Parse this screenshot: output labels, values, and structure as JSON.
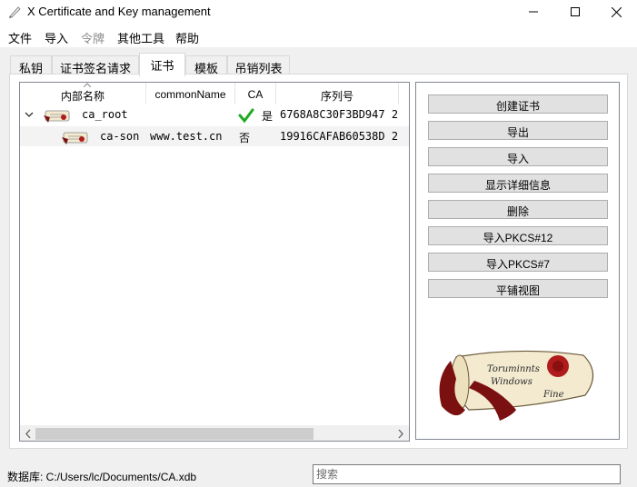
{
  "window": {
    "title": "X Certificate and Key management"
  },
  "menu": [
    "文件",
    "导入",
    "令牌",
    "其他工具",
    "帮助"
  ],
  "tabs": [
    "私钥",
    "证书签名请求",
    "证书",
    "模板",
    "吊销列表"
  ],
  "active_tab": "证书",
  "columns": [
    "内部名称",
    "commonName",
    "CA",
    "序列号"
  ],
  "rows": [
    {
      "name": "ca_root",
      "common_name": "",
      "ca": "是",
      "ca_valid": true,
      "serial": "6768A8C30F3BD947 2"
    },
    {
      "name": "ca-son",
      "common_name": "www.test.cn",
      "ca": "否",
      "ca_valid": false,
      "serial": "19916CAFAB60538D 2"
    }
  ],
  "buttons": [
    "创建证书",
    "导出",
    "导入",
    "显示详细信息",
    "删除",
    "导入PKCS#12",
    "导入PKCS#7",
    "平铺视图"
  ],
  "status": {
    "database_label": "数据库: C:/Users/lc/Documents/CA.xdb"
  },
  "search": {
    "placeholder": "搜索"
  },
  "art": {
    "line1": "Toruminnts",
    "line2": "Windows",
    "line3": "Fine"
  },
  "colors": {
    "check": "#1faa1f",
    "seal": "#b01c1c",
    "ribbon": "#7a1010",
    "parchment": "#f3ead0"
  }
}
